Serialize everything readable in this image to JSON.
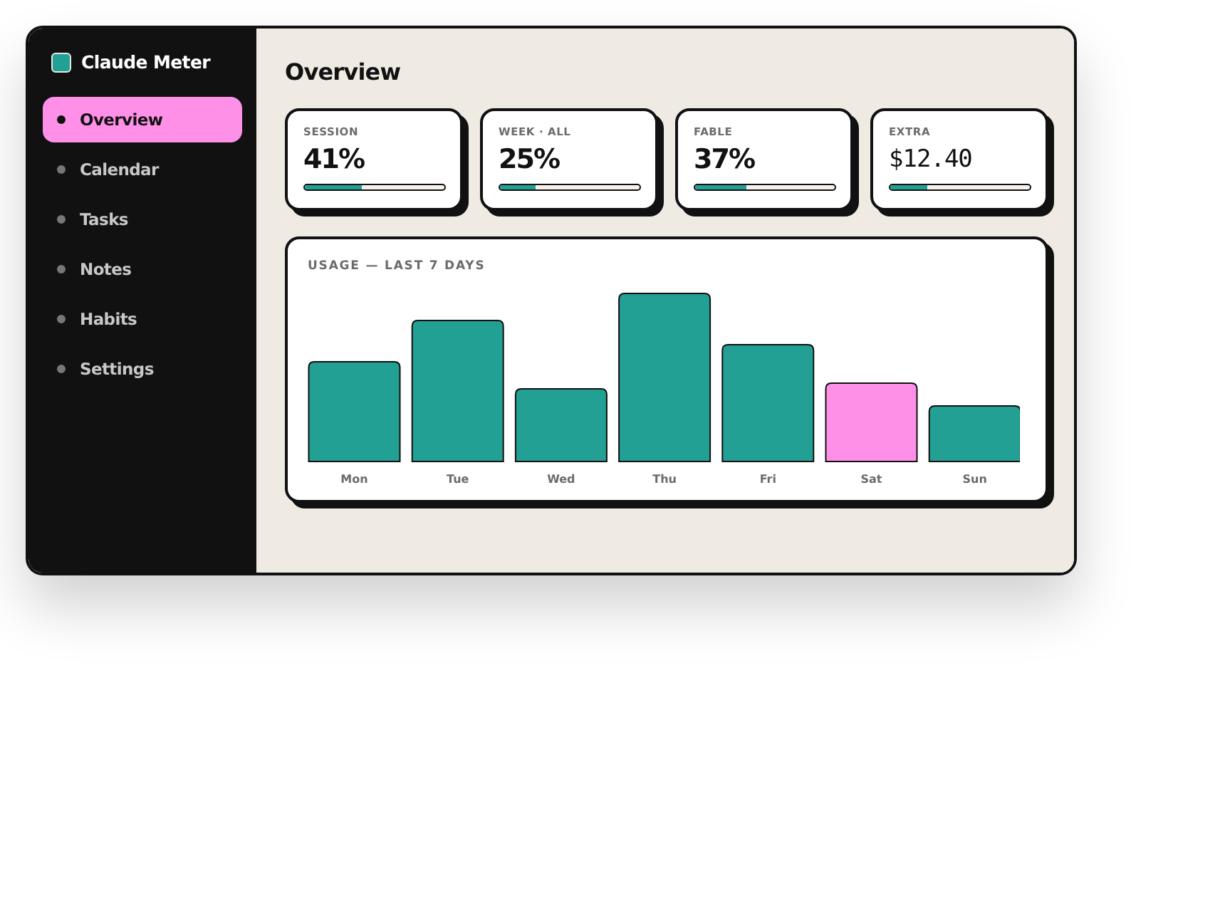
{
  "app": {
    "title": "Claude Meter"
  },
  "sidebar": {
    "items": [
      {
        "label": "Overview",
        "selected": true
      },
      {
        "label": "Calendar",
        "selected": false
      },
      {
        "label": "Tasks",
        "selected": false
      },
      {
        "label": "Notes",
        "selected": false
      },
      {
        "label": "Habits",
        "selected": false
      },
      {
        "label": "Settings",
        "selected": false
      }
    ]
  },
  "page": {
    "title": "Overview"
  },
  "stats": [
    {
      "label": "SESSION",
      "value": "41%",
      "level": 0.41,
      "kind": "percent"
    },
    {
      "label": "WEEK · ALL",
      "value": "25%",
      "level": 0.25,
      "kind": "percent"
    },
    {
      "label": "FABLE",
      "value": "37%",
      "level": 0.37,
      "kind": "percent"
    },
    {
      "label": "EXTRA",
      "value": "$12.40",
      "level": 0.27,
      "kind": "currency"
    }
  ],
  "usage_chart": {
    "title": "USAGE — LAST 7 DAYS",
    "days": [
      {
        "label": "Mon",
        "color": "#22a094"
      },
      {
        "label": "Tue",
        "color": "#22a094"
      },
      {
        "label": "Wed",
        "color": "#22a094"
      },
      {
        "label": "Thu",
        "color": "#22a094"
      },
      {
        "label": "Fri",
        "color": "#22a094"
      },
      {
        "label": "Sat",
        "color": "#ff90e8"
      },
      {
        "label": "Sun",
        "color": "#22a094"
      }
    ]
  }
}
